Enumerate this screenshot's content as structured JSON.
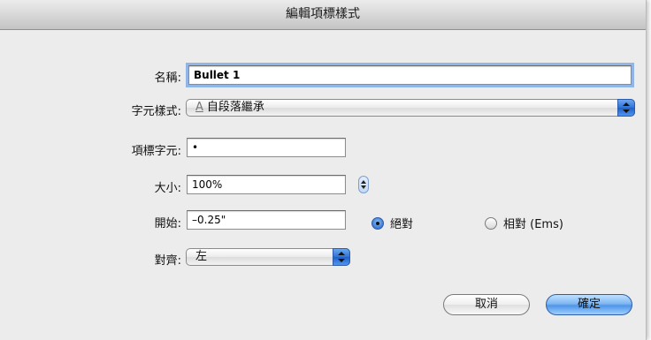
{
  "dialog": {
    "title": "編輯項標樣式"
  },
  "form": {
    "name_label": "名稱:",
    "name_value": "Bullet 1",
    "char_style_label": "字元樣式:",
    "char_style_icon": "A",
    "char_style_value": "自段落繼承",
    "bullet_char_label": "項標字元:",
    "bullet_char_value": "•",
    "size_label": "大小:",
    "size_value": "100%",
    "start_label": "開始:",
    "start_value": "–0.25\"",
    "absolute_label": "絕對",
    "relative_label": "相對 (Ems)",
    "align_label": "對齊:",
    "align_value": "左"
  },
  "state": {
    "start_mode": "absolute"
  },
  "buttons": {
    "cancel": "取消",
    "ok": "確定"
  },
  "colors": {
    "accent": "#3a7bd9",
    "focus_ring": "#8fb6e6"
  }
}
